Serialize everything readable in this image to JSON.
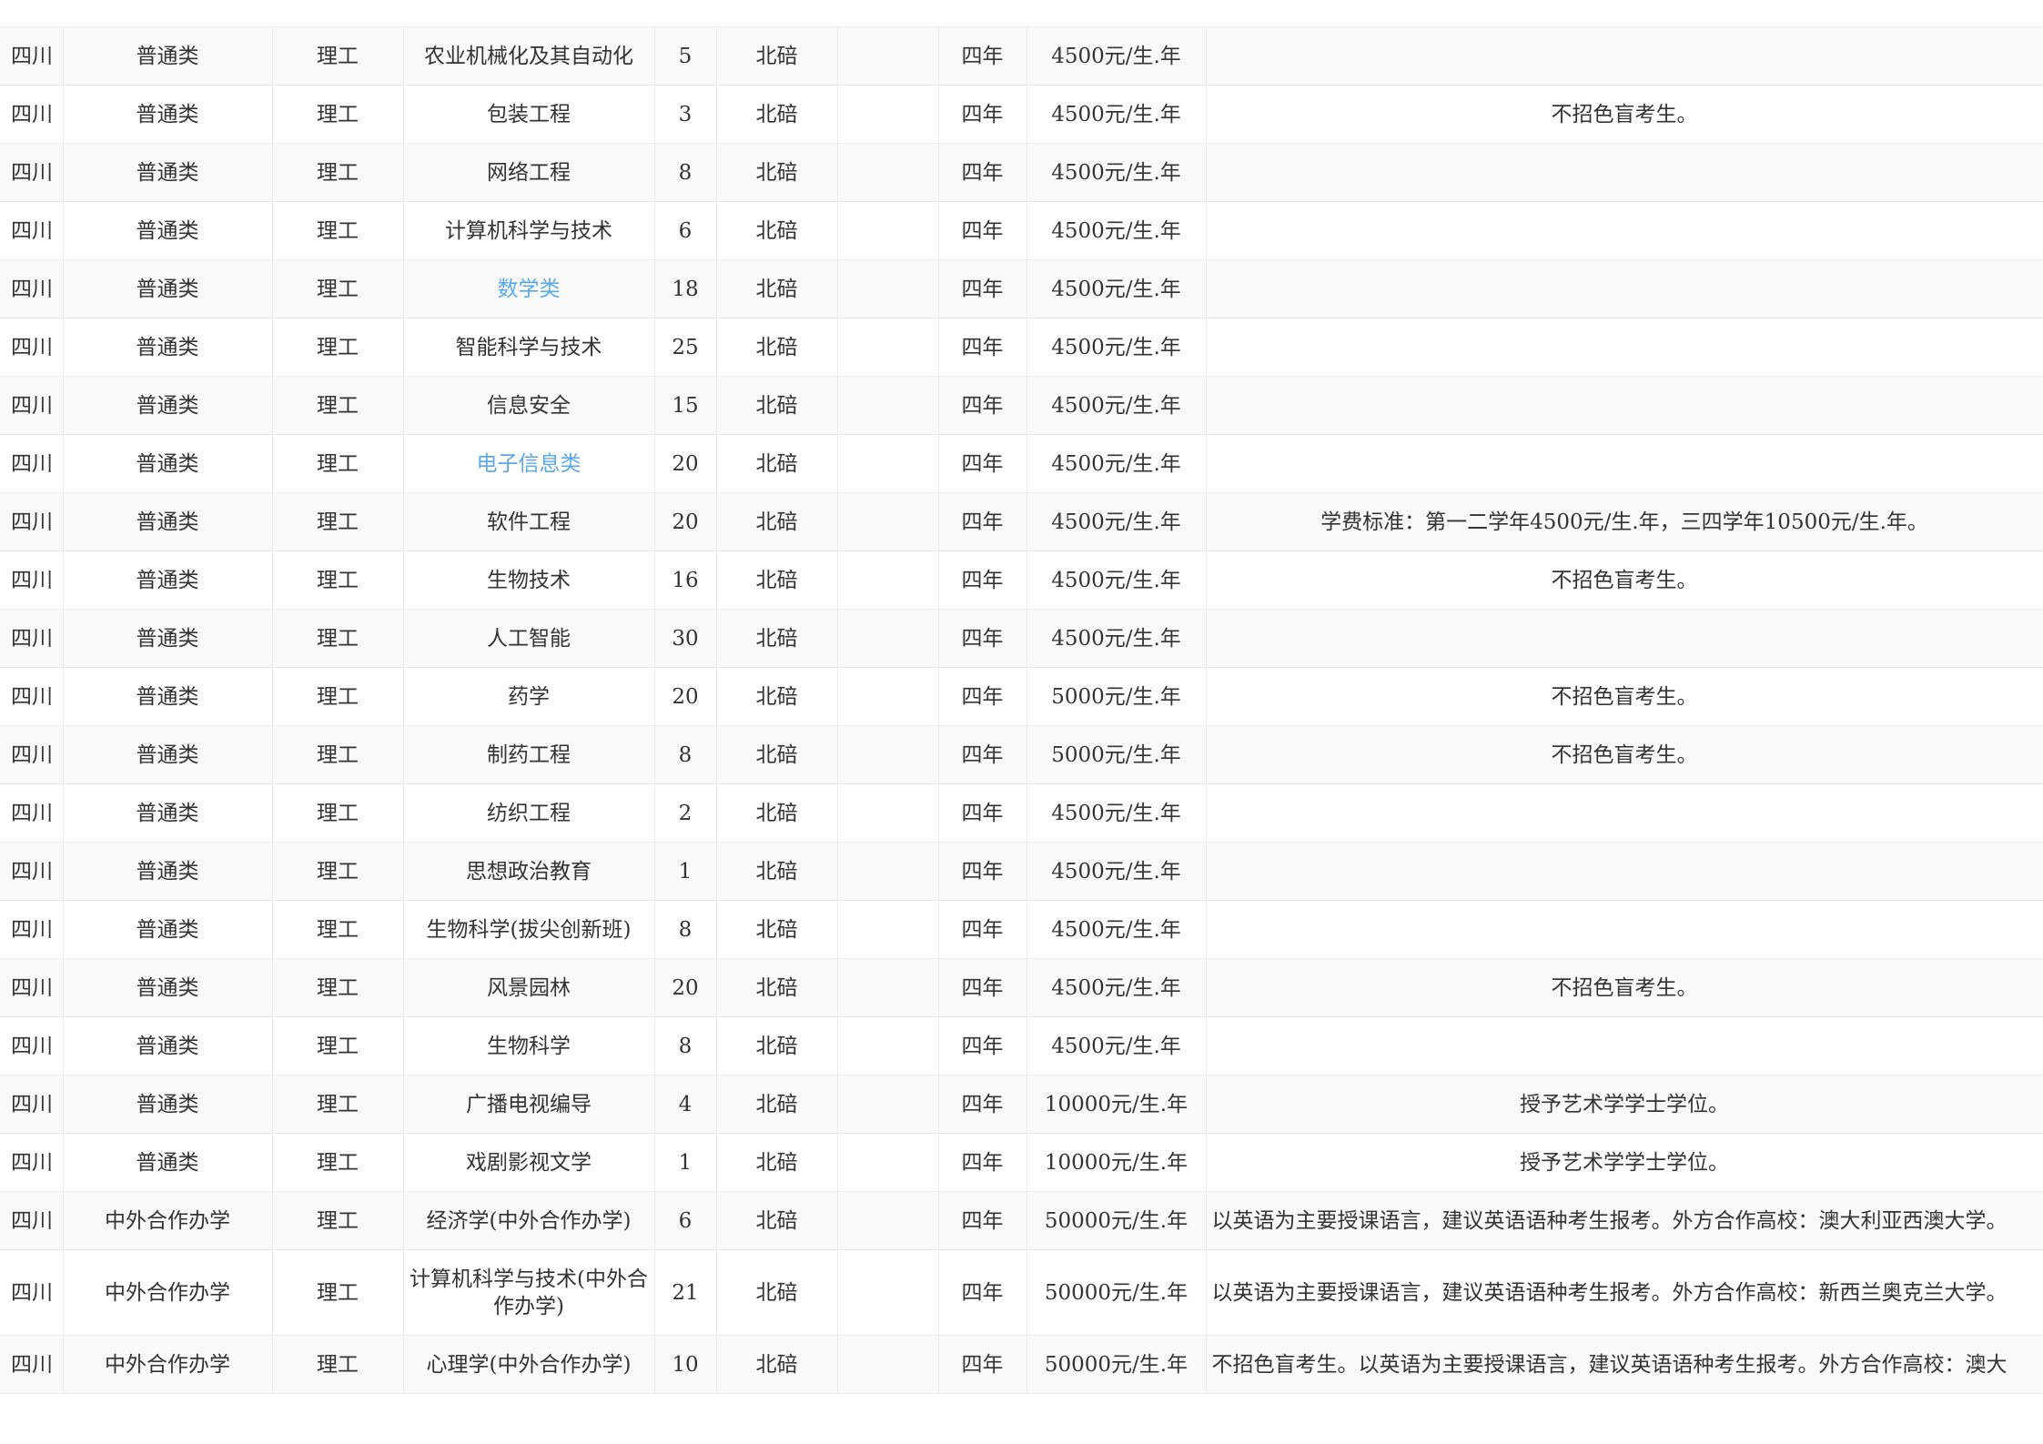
{
  "rows": [
    {
      "province": "四川",
      "category": "普通类",
      "subject": "理工",
      "major": "农业机械化及其自动化",
      "major_link": false,
      "count": "5",
      "campus": "北碚",
      "extra": "",
      "duration": "四年",
      "fee": "4500元/生.年",
      "remark": "",
      "remark_align": "center"
    },
    {
      "province": "四川",
      "category": "普通类",
      "subject": "理工",
      "major": "包装工程",
      "major_link": false,
      "count": "3",
      "campus": "北碚",
      "extra": "",
      "duration": "四年",
      "fee": "4500元/生.年",
      "remark": "不招色盲考生。",
      "remark_align": "center"
    },
    {
      "province": "四川",
      "category": "普通类",
      "subject": "理工",
      "major": "网络工程",
      "major_link": false,
      "count": "8",
      "campus": "北碚",
      "extra": "",
      "duration": "四年",
      "fee": "4500元/生.年",
      "remark": "",
      "remark_align": "center"
    },
    {
      "province": "四川",
      "category": "普通类",
      "subject": "理工",
      "major": "计算机科学与技术",
      "major_link": false,
      "count": "6",
      "campus": "北碚",
      "extra": "",
      "duration": "四年",
      "fee": "4500元/生.年",
      "remark": "",
      "remark_align": "center"
    },
    {
      "province": "四川",
      "category": "普通类",
      "subject": "理工",
      "major": "数学类",
      "major_link": true,
      "count": "18",
      "campus": "北碚",
      "extra": "",
      "duration": "四年",
      "fee": "4500元/生.年",
      "remark": "",
      "remark_align": "center"
    },
    {
      "province": "四川",
      "category": "普通类",
      "subject": "理工",
      "major": "智能科学与技术",
      "major_link": false,
      "count": "25",
      "campus": "北碚",
      "extra": "",
      "duration": "四年",
      "fee": "4500元/生.年",
      "remark": "",
      "remark_align": "center"
    },
    {
      "province": "四川",
      "category": "普通类",
      "subject": "理工",
      "major": "信息安全",
      "major_link": false,
      "count": "15",
      "campus": "北碚",
      "extra": "",
      "duration": "四年",
      "fee": "4500元/生.年",
      "remark": "",
      "remark_align": "center"
    },
    {
      "province": "四川",
      "category": "普通类",
      "subject": "理工",
      "major": "电子信息类",
      "major_link": true,
      "count": "20",
      "campus": "北碚",
      "extra": "",
      "duration": "四年",
      "fee": "4500元/生.年",
      "remark": "",
      "remark_align": "center"
    },
    {
      "province": "四川",
      "category": "普通类",
      "subject": "理工",
      "major": "软件工程",
      "major_link": false,
      "count": "20",
      "campus": "北碚",
      "extra": "",
      "duration": "四年",
      "fee": "4500元/生.年",
      "remark": "学费标准：第一二学年4500元/生.年，三四学年10500元/生.年。",
      "remark_align": "center"
    },
    {
      "province": "四川",
      "category": "普通类",
      "subject": "理工",
      "major": "生物技术",
      "major_link": false,
      "count": "16",
      "campus": "北碚",
      "extra": "",
      "duration": "四年",
      "fee": "4500元/生.年",
      "remark": "不招色盲考生。",
      "remark_align": "center"
    },
    {
      "province": "四川",
      "category": "普通类",
      "subject": "理工",
      "major": "人工智能",
      "major_link": false,
      "count": "30",
      "campus": "北碚",
      "extra": "",
      "duration": "四年",
      "fee": "4500元/生.年",
      "remark": "",
      "remark_align": "center"
    },
    {
      "province": "四川",
      "category": "普通类",
      "subject": "理工",
      "major": "药学",
      "major_link": false,
      "count": "20",
      "campus": "北碚",
      "extra": "",
      "duration": "四年",
      "fee": "5000元/生.年",
      "remark": "不招色盲考生。",
      "remark_align": "center"
    },
    {
      "province": "四川",
      "category": "普通类",
      "subject": "理工",
      "major": "制药工程",
      "major_link": false,
      "count": "8",
      "campus": "北碚",
      "extra": "",
      "duration": "四年",
      "fee": "5000元/生.年",
      "remark": "不招色盲考生。",
      "remark_align": "center"
    },
    {
      "province": "四川",
      "category": "普通类",
      "subject": "理工",
      "major": "纺织工程",
      "major_link": false,
      "count": "2",
      "campus": "北碚",
      "extra": "",
      "duration": "四年",
      "fee": "4500元/生.年",
      "remark": "",
      "remark_align": "center"
    },
    {
      "province": "四川",
      "category": "普通类",
      "subject": "理工",
      "major": "思想政治教育",
      "major_link": false,
      "count": "1",
      "campus": "北碚",
      "extra": "",
      "duration": "四年",
      "fee": "4500元/生.年",
      "remark": "",
      "remark_align": "center"
    },
    {
      "province": "四川",
      "category": "普通类",
      "subject": "理工",
      "major": "生物科学(拔尖创新班)",
      "major_link": false,
      "count": "8",
      "campus": "北碚",
      "extra": "",
      "duration": "四年",
      "fee": "4500元/生.年",
      "remark": "",
      "remark_align": "center"
    },
    {
      "province": "四川",
      "category": "普通类",
      "subject": "理工",
      "major": "风景园林",
      "major_link": false,
      "count": "20",
      "campus": "北碚",
      "extra": "",
      "duration": "四年",
      "fee": "4500元/生.年",
      "remark": "不招色盲考生。",
      "remark_align": "center"
    },
    {
      "province": "四川",
      "category": "普通类",
      "subject": "理工",
      "major": "生物科学",
      "major_link": false,
      "count": "8",
      "campus": "北碚",
      "extra": "",
      "duration": "四年",
      "fee": "4500元/生.年",
      "remark": "",
      "remark_align": "center"
    },
    {
      "province": "四川",
      "category": "普通类",
      "subject": "理工",
      "major": "广播电视编导",
      "major_link": false,
      "count": "4",
      "campus": "北碚",
      "extra": "",
      "duration": "四年",
      "fee": "10000元/生.年",
      "remark": "授予艺术学学士学位。",
      "remark_align": "center"
    },
    {
      "province": "四川",
      "category": "普通类",
      "subject": "理工",
      "major": "戏剧影视文学",
      "major_link": false,
      "count": "1",
      "campus": "北碚",
      "extra": "",
      "duration": "四年",
      "fee": "10000元/生.年",
      "remark": "授予艺术学学士学位。",
      "remark_align": "center"
    },
    {
      "province": "四川",
      "category": "中外合作办学",
      "subject": "理工",
      "major": "经济学(中外合作办学)",
      "major_link": false,
      "count": "6",
      "campus": "北碚",
      "extra": "",
      "duration": "四年",
      "fee": "50000元/生.年",
      "remark": "以英语为主要授课语言，建议英语语种考生报考。外方合作高校：澳大利亚西澳大学。",
      "remark_align": "left"
    },
    {
      "province": "四川",
      "category": "中外合作办学",
      "subject": "理工",
      "major": "计算机科学与技术(中外合作办学)",
      "major_link": false,
      "count": "21",
      "campus": "北碚",
      "extra": "",
      "duration": "四年",
      "fee": "50000元/生.年",
      "remark": "以英语为主要授课语言，建议英语语种考生报考。外方合作高校：新西兰奥克兰大学。",
      "remark_align": "left",
      "tall": true
    },
    {
      "province": "四川",
      "category": "中外合作办学",
      "subject": "理工",
      "major": "心理学(中外合作办学)",
      "major_link": false,
      "count": "10",
      "campus": "北碚",
      "extra": "",
      "duration": "四年",
      "fee": "50000元/生.年",
      "remark": "不招色盲考生。以英语为主要授课语言，建议英语语种考生报考。外方合作高校：澳大",
      "remark_align": "left"
    }
  ]
}
